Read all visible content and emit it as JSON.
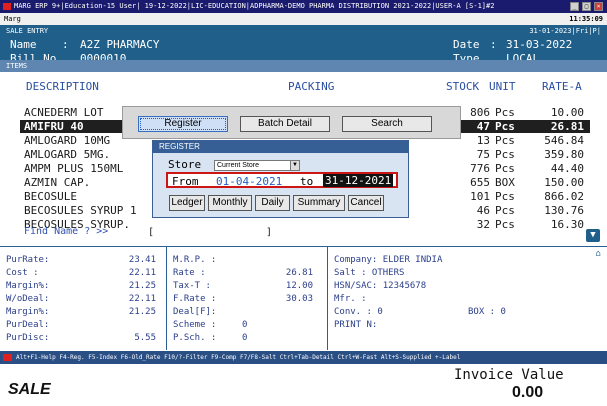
{
  "window": {
    "title": "MARG ERP 9+|Education-15 User| 19-12-2022|LIC-EDUCATION|ADPHARMA-DEMO PHARMA DISTRIBUTION 2021-2022|USER-A [S-1]#2",
    "menu_label": "Marg",
    "clock": "11:35:09"
  },
  "entry": {
    "title": "SALE ENTRY",
    "top_date": "31-01-2023|Fri|P|",
    "name_label": "Name",
    "name_sep": ":",
    "name_value": "A2Z PHARMACY",
    "bill_label": "Bill No.",
    "bill_value": "0000010",
    "date_label": "Date",
    "date_sep": ":",
    "date_value": "31-03-2022",
    "type_label": "Type",
    "type_value": "LOCAL"
  },
  "items": {
    "section_label": "ITEMS",
    "columns": {
      "description": "DESCRIPTION",
      "packing": "PACKING",
      "stock": "STOCK",
      "unit": "UNIT",
      "rate": "RATE-A"
    },
    "rows": [
      {
        "name": "ACNEDERM LOT",
        "stock": "806",
        "unit": "Pcs",
        "rate": "10.00"
      },
      {
        "name": "AMIFRU 40",
        "stock": "47",
        "unit": "Pcs",
        "rate": "26.81"
      },
      {
        "name": "AMLOGARD 10MG",
        "stock": "13",
        "unit": "Pcs",
        "rate": "546.84"
      },
      {
        "name": "AMLOGARD 5MG.",
        "stock": "75",
        "unit": "Pcs",
        "rate": "359.80"
      },
      {
        "name": "AMPM PLUS 150ML",
        "stock": "776",
        "unit": "Pcs",
        "rate": "44.40"
      },
      {
        "name": "AZMIN CAP.",
        "stock": "655",
        "unit": "BOX",
        "rate": "150.00"
      },
      {
        "name": "BECOSULE",
        "stock": "101",
        "unit": "Pcs",
        "rate": "866.02"
      },
      {
        "name": "BECOSULES SYRUP 1",
        "stock": "46",
        "unit": "Pcs",
        "rate": "130.76"
      },
      {
        "name": "BECOSULES SYRUP.",
        "stock": "32",
        "unit": "Pcs",
        "rate": "16.30"
      }
    ],
    "selected_index": 1,
    "find_label": "Find Name ? >>",
    "find_bracket_open": "[",
    "find_bracket_close": "]"
  },
  "toolbar_dialog": {
    "register": "Register",
    "batch_detail": "Batch Detail",
    "search": "Search"
  },
  "register_dialog": {
    "title": "REGISTER",
    "store_label": "Store",
    "store_value": "Current Store",
    "from_label": "From",
    "from_date": "01-04-2021",
    "to_label": "to",
    "to_date": "31-12-2021",
    "buttons": {
      "ledger": "Ledger",
      "monthly": "Monthly",
      "daily": "Daily",
      "summary": "Summary",
      "cancel": "Cancel"
    }
  },
  "info": {
    "left": [
      {
        "label": "PurRate:",
        "value": "23.41"
      },
      {
        "label": "Cost    :",
        "value": "22.11"
      },
      {
        "label": "Margin%:",
        "value": "21.25"
      },
      {
        "label": "W/oDeal:",
        "value": "22.11"
      },
      {
        "label": "Margin%:",
        "value": "21.25"
      },
      {
        "label": "PurDeal:",
        "value": ""
      },
      {
        "label": "PurDisc:",
        "value": "5.55"
      }
    ],
    "mid": [
      {
        "label": "M.R.P.  :",
        "value": ""
      },
      {
        "label": "Rate    :",
        "value": "26.81"
      },
      {
        "label": "Tax-T   :",
        "value": "12.00"
      },
      {
        "label": "F.Rate  :",
        "value": "30.03"
      },
      {
        "label": "Deal[F]:",
        "value": ""
      },
      {
        "label": "Scheme  :",
        "value": "0"
      },
      {
        "label": "P.Sch.  :",
        "value": "0"
      }
    ],
    "right": {
      "company": "Company: ELDER INDIA",
      "salt": "Salt   : OTHERS",
      "hsn": "HSN/SAC: 12345678",
      "mfr": "Mfr.   :",
      "conv": "Conv.  : 0",
      "box": "BOX    : 0",
      "print": "PRINT N:"
    }
  },
  "shortcuts": "Alt+F1-Help F4-Reg. F5-Index F6-Old_Rate F10/?-Filter F9-Comp F7/F8-Salt Ctrl+Tab-Detail Ctrl+W-Fast Alt+S-Supplied +-Label",
  "footer": {
    "mode": "SALE",
    "invoice_label": "Invoice Value",
    "invoice_value": "0.00"
  }
}
